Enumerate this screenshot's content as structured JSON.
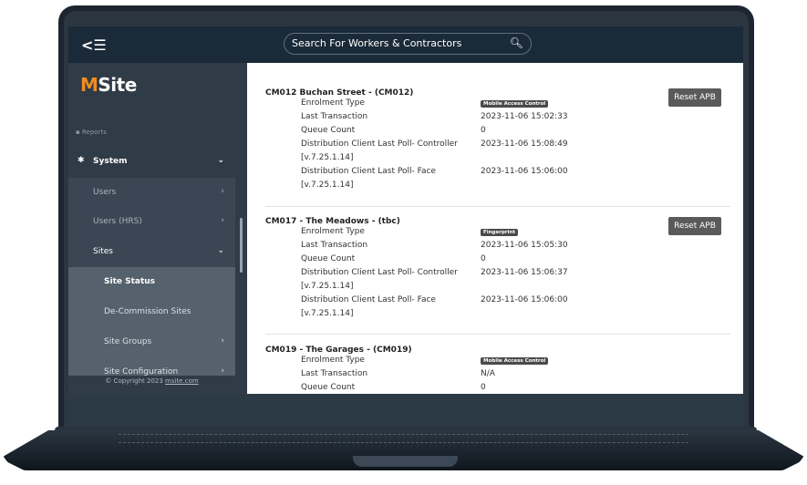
{
  "topbar": {
    "menu_icon": "☰",
    "menu_back": "<",
    "search_placeholder": "Search For Workers & Contractors"
  },
  "logo": {
    "m": "M",
    "rest": "Site"
  },
  "sidebar": {
    "faded_item": "Reports",
    "system": "System",
    "users": "Users",
    "users_hrs": "Users (HRS)",
    "sites": "Sites",
    "site_status": "Site Status",
    "decommission": "De-Commission Sites",
    "site_groups": "Site Groups",
    "site_config": "Site Configuration",
    "copyright_prefix": "© Copyright 2023 ",
    "copyright_link": "msite.com"
  },
  "reset_label": "Reset APB",
  "cards": [
    {
      "title": "CM012 Buchan Street - (CM012)",
      "enrolment_label": "Enrolment Type",
      "enrolment_value": "Mobile Access Control",
      "last_tx_label": "Last Transaction",
      "last_tx_value": "2023-11-06 15:02:33",
      "queue_label": "Queue Count",
      "queue_value": "0",
      "dc_controller_label": "Distribution Client Last Poll- Controller",
      "dc_controller_value": "2023-11-06 15:08:49",
      "dc_controller_version": "[v.7.25.1.14]",
      "dc_face_label": "Distribution Client Last Poll- Face",
      "dc_face_value": "2023-11-06 15:06:00",
      "dc_face_version": "[v.7.25.1.14]"
    },
    {
      "title": "CM017 - The Meadows - (tbc)",
      "enrolment_label": "Enrolment Type",
      "enrolment_value": "Fingerprint",
      "last_tx_label": "Last Transaction",
      "last_tx_value": "2023-11-06 15:05:30",
      "queue_label": "Queue Count",
      "queue_value": "0",
      "dc_controller_label": "Distribution Client Last Poll- Controller",
      "dc_controller_value": "2023-11-06 15:06:37",
      "dc_controller_version": "[v.7.25.1.14]",
      "dc_face_label": "Distribution Client Last Poll- Face",
      "dc_face_value": "2023-11-06 15:06:00",
      "dc_face_version": "[v.7.25.1.14]"
    },
    {
      "title": "CM019 - The Garages - (CM019)",
      "enrolment_label": "Enrolment Type",
      "enrolment_value": "Mobile Access Control",
      "last_tx_label": "Last Transaction",
      "last_tx_value": "N/A",
      "queue_label": "Queue Count",
      "queue_value": "0"
    }
  ]
}
